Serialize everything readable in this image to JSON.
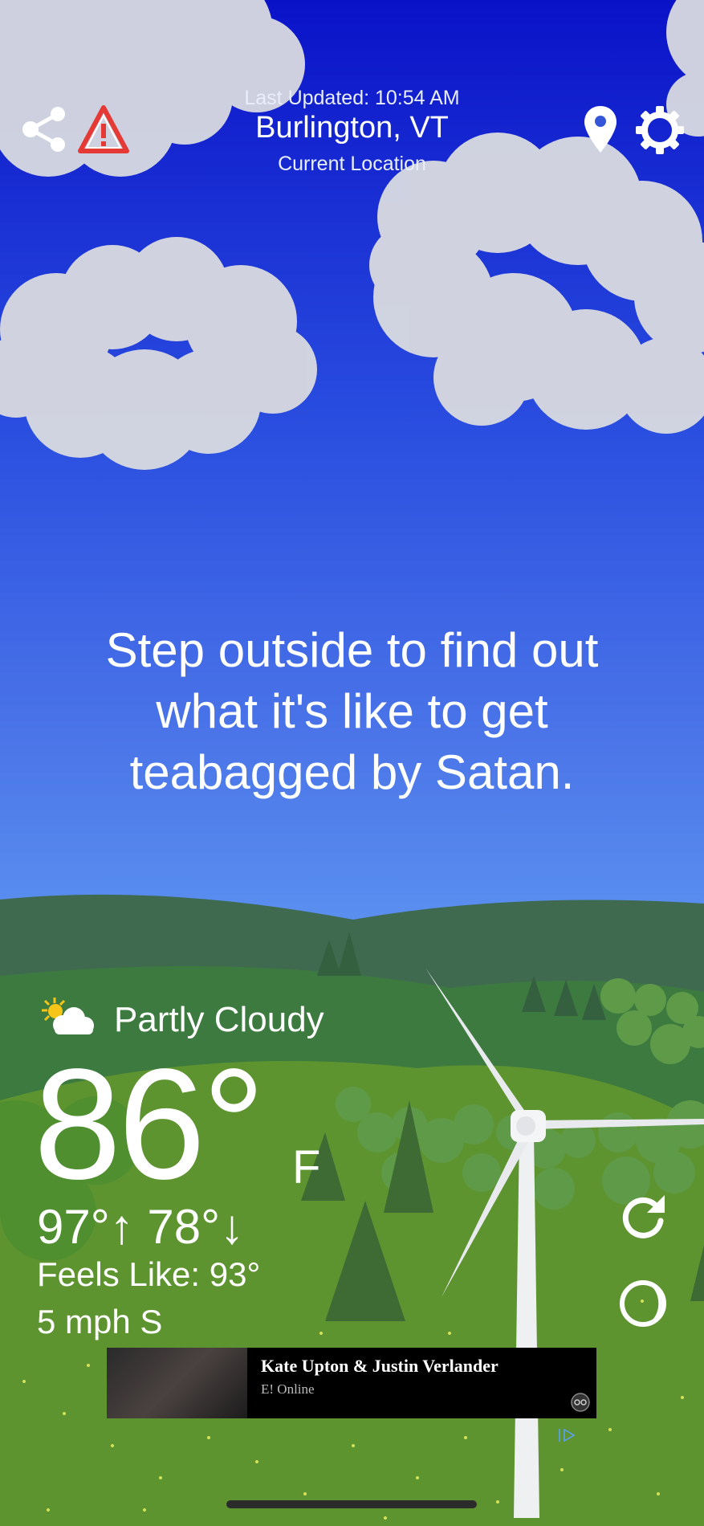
{
  "header": {
    "last_updated": "Last Updated: 10:54 AM",
    "city": "Burlington, VT",
    "location_label": "Current Location"
  },
  "message": {
    "line1": "Step outside to find out",
    "line2": "what it's like to get",
    "line3": "teabagged by Satan."
  },
  "weather": {
    "condition": "Partly Cloudy",
    "condition_icon": "partly-cloudy-icon",
    "temperature": "86°",
    "unit": "F",
    "high_low": "97°↑ 78°↓",
    "feels_like": "Feels Like: 93°",
    "wind": "5 mph S"
  },
  "ad": {
    "title": "Kate Upton & Justin Verlander",
    "source": "E! Online"
  },
  "icons": {
    "share": "share-icon",
    "alert": "warning-triangle-icon",
    "location": "location-pin-icon",
    "settings": "gear-icon",
    "refresh": "refresh-icon",
    "moon": "moon-icon"
  },
  "colors": {
    "sky_top": "#0a12c8",
    "sky_bottom": "#6aa8f6",
    "hill_far": "#3f6a50",
    "grass": "#5e9430",
    "alert_red": "#e53935"
  }
}
